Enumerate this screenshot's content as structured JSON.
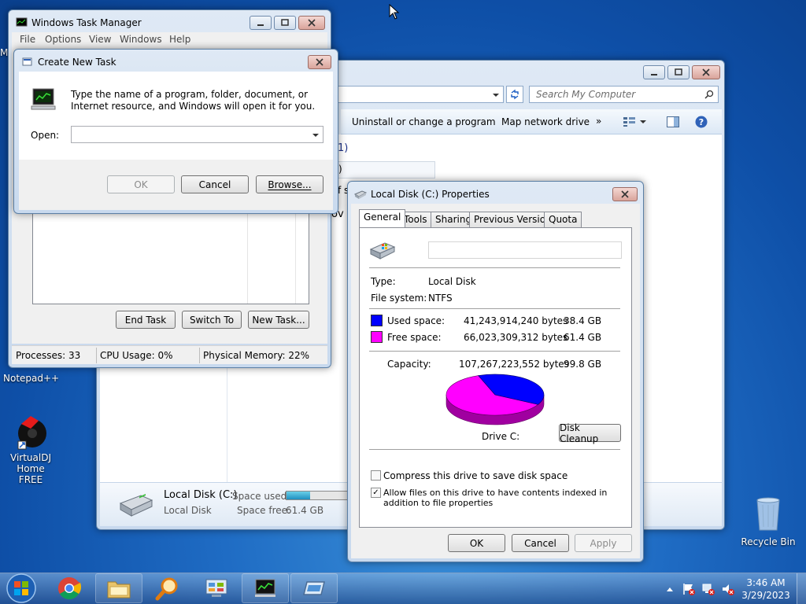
{
  "desktop": {
    "icons": [
      {
        "label": "Notepad++"
      },
      {
        "label": "VirtualDJ Home FREE"
      },
      {
        "label": "Recycle Bin"
      }
    ],
    "partial_label": "M"
  },
  "task_manager": {
    "title": "Windows Task Manager",
    "menu": [
      "File",
      "Options",
      "View",
      "Windows",
      "Help"
    ],
    "buttons": {
      "end_task": "End Task",
      "switch_to": "Switch To",
      "new_task": "New Task..."
    },
    "status": {
      "processes": "Processes: 33",
      "cpu": "CPU Usage: 0%",
      "memory": "Physical Memory: 22%"
    }
  },
  "create_task": {
    "title": "Create New Task",
    "description": "Type the name of a program, folder, document, or Internet resource, and Windows will open it for you.",
    "open_label": "Open:",
    "open_value": "",
    "buttons": {
      "ok": "OK",
      "cancel": "Cancel",
      "browse": "Browse..."
    }
  },
  "explorer": {
    "search_placeholder": "Search My Computer",
    "toolbar": {
      "uninstall": "Uninstall or change a program",
      "map_drive": "Map network drive",
      "more": "»"
    },
    "fragments": {
      "count": "1)",
      "paren": ")",
      "of": "f s",
      "ov": "ov"
    },
    "details": {
      "name": "Local Disk (C:)",
      "type": "Local Disk",
      "used_label": "Space used:",
      "free_label": "Space free:",
      "free_value": "61.4 GB",
      "used_fraction": 0.384
    }
  },
  "properties": {
    "title": "Local Disk (C:) Properties",
    "tabs": [
      "General",
      "Tools",
      "Sharing",
      "Previous Versions",
      "Quota"
    ],
    "active_tab": "General",
    "label_value": "",
    "type_label": "Type:",
    "type_value": "Local Disk",
    "fs_label": "File system:",
    "fs_value": "NTFS",
    "used": {
      "label": "Used space:",
      "bytes": "41,243,914,240 bytes",
      "gb": "38.4 GB",
      "color": "#0000ff"
    },
    "free": {
      "label": "Free space:",
      "bytes": "66,023,309,312 bytes",
      "gb": "61.4 GB",
      "color": "#ff00ff"
    },
    "capacity": {
      "label": "Capacity:",
      "bytes": "107,267,223,552 bytes",
      "gb": "99.8 GB"
    },
    "drive_label": "Drive C:",
    "disk_cleanup": "Disk Cleanup",
    "compress_label": "Compress this drive to save disk space",
    "compress_checked": false,
    "index_label": "Allow files on this drive to have contents indexed in addition to file properties",
    "index_checked": true,
    "buttons": {
      "ok": "OK",
      "cancel": "Cancel",
      "apply": "Apply"
    }
  },
  "taskbar": {
    "time": "3:46 AM",
    "date": "3/29/2023"
  }
}
